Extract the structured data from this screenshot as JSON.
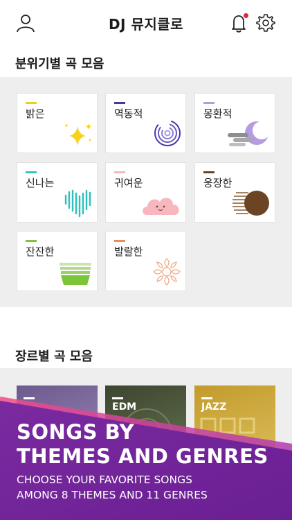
{
  "header": {
    "title": "DJ 뮤지클로"
  },
  "mood_section": {
    "title": "분위기별 곡 모음",
    "items": [
      {
        "label": "밝은",
        "color": "#f2cc1c",
        "icon": "sparkle-icon"
      },
      {
        "label": "역동적",
        "color": "#4a35a8",
        "icon": "spiral-icon"
      },
      {
        "label": "몽환적",
        "color": "#b49ad8",
        "icon": "moon-cloud-icon"
      },
      {
        "label": "신나는",
        "color": "#31c6c0",
        "icon": "heart-wave-icon"
      },
      {
        "label": "귀여운",
        "color": "#f6b8bf",
        "icon": "smiling-cloud-icon"
      },
      {
        "label": "웅장한",
        "color": "#6b4423",
        "icon": "eclipse-icon"
      },
      {
        "label": "잔잔한",
        "color": "#7cc43a",
        "icon": "bowl-icon"
      },
      {
        "label": "발랄한",
        "color": "#ef8a5a",
        "icon": "flower-icon"
      }
    ]
  },
  "genre_section": {
    "title": "장르별 곡 모음",
    "items": [
      {
        "label": "",
        "color": "#7a6a9a"
      },
      {
        "label": "EDM",
        "color": "#4f5a3e"
      },
      {
        "label": "JAZZ",
        "color": "#c9a33a"
      }
    ]
  },
  "promo": {
    "headline_line1": "SONGS BY",
    "headline_line2": "THEMES AND GENRES",
    "sub_line1": "CHOOSE YOUR FAVORITE SONGS",
    "sub_line2": "AMONG 8 THEMES AND 11 GENRES",
    "color": "#7b2aa0"
  }
}
